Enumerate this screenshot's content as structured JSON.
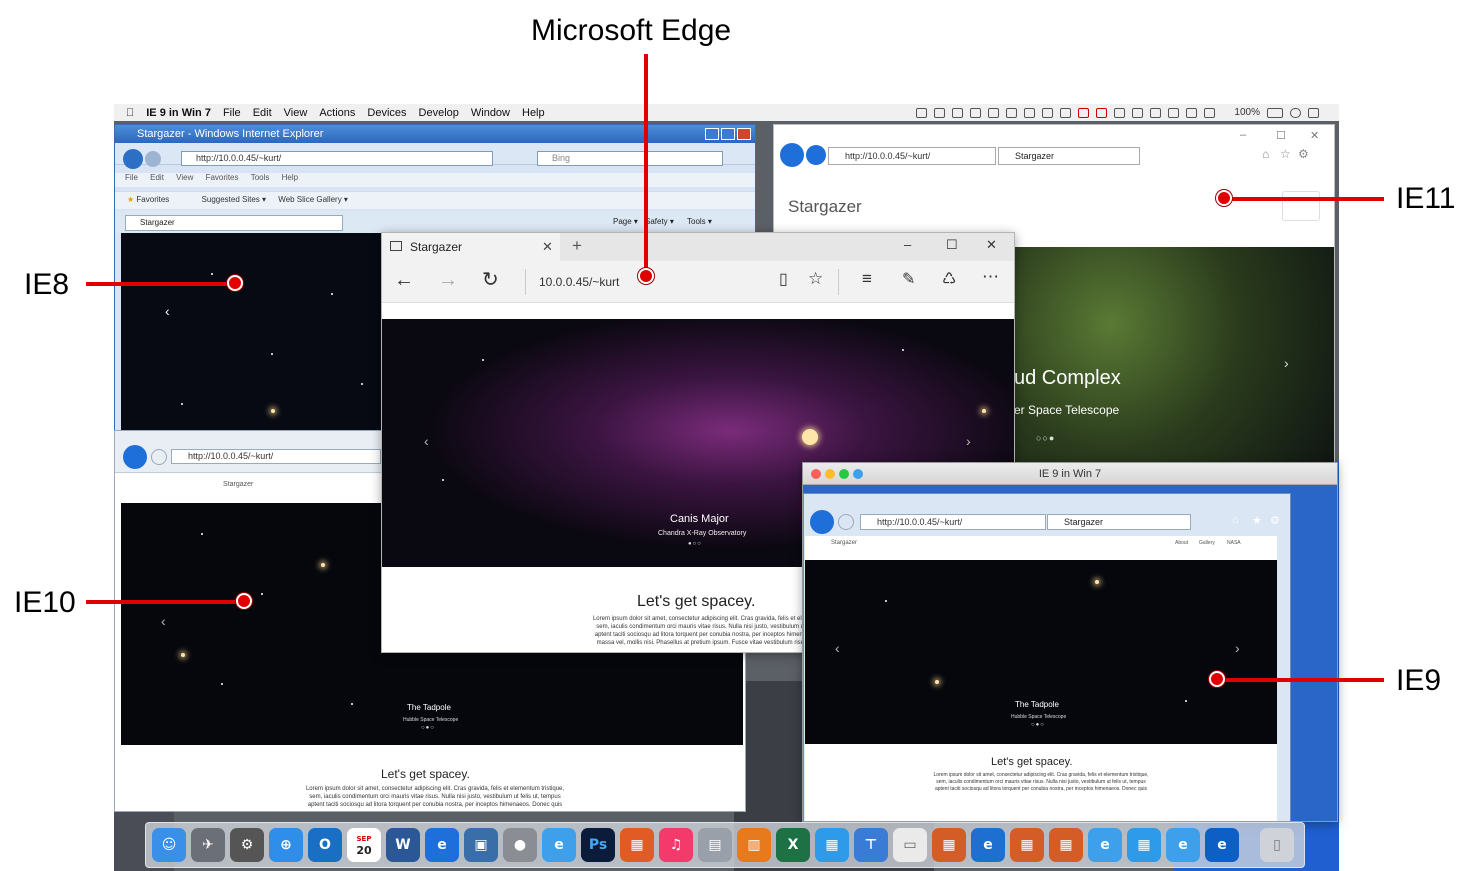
{
  "callouts": {
    "edge": "Microsoft Edge",
    "ie11": "IE11",
    "ie8": "IE8",
    "ie10": "IE10",
    "ie9": "IE9"
  },
  "menubar": {
    "app": "IE 9 in Win 7",
    "items": [
      "File",
      "Edit",
      "View",
      "Actions",
      "Devices",
      "Develop",
      "Window",
      "Help"
    ],
    "battery": "100%"
  },
  "ie8": {
    "title": "Stargazer - Windows Internet Explorer",
    "url": "http://10.0.0.45/~kurt/",
    "search_placeholder": "Bing",
    "menu": [
      "File",
      "Edit",
      "View",
      "Favorites",
      "Tools",
      "Help"
    ],
    "favorites": "Favorites",
    "suggested": "Suggested Sites ▾",
    "slice": "Web Slice Gallery ▾",
    "tab": "Stargazer",
    "commands": [
      "Page ▾",
      "Safety ▾",
      "Tools ▾"
    ]
  },
  "ie11": {
    "url": "http://10.0.0.45/~kurt/",
    "tab": "Stargazer",
    "brand": "Stargazer",
    "caption_title": "ud Complex",
    "caption_sub": "er Space Telescope"
  },
  "edge": {
    "tab": "Stargazer",
    "url": "10.0.0.45/~kurt",
    "caption_title": "Canis Major",
    "caption_sub": "Chandra X-Ray Observatory",
    "heading": "Let's get spacey.",
    "lorem1": "Lorem ipsum dolor sit amet, consectetur adipiscing elit. Cras gravida, felis et elementum tristique,",
    "lorem2": "sem, iaculis condimentum orci mauris vitae risus. Nulla nisi justo, vestibulum ut felis ut, tempus",
    "lorem3": "aptent taciti sociosqu ad litora torquent per conubia nostra, per inceptos himenaeos. Donec quis",
    "lorem4": "massa vel, mollis nisi. Phasellus at pretium ipsum. Fusce vitae vestibulum risus. Fusce fringilla"
  },
  "ie10": {
    "url": "http://10.0.0.45/~kurt/",
    "brand": "Stargazer",
    "caption_title": "The Tadpole",
    "caption_sub": "Hubble Space Telescope",
    "heading": "Let's get spacey."
  },
  "ie9": {
    "window_title": "IE 9 in Win 7",
    "url": "http://10.0.0.45/~kurt/",
    "tab": "Stargazer",
    "brand": "Stargazer",
    "nav": [
      "About",
      "Gallery",
      "NASA"
    ],
    "caption_title": "The Tadpole",
    "caption_sub": "Hubble Space Telescope",
    "heading": "Let's get spacey."
  },
  "dock": {
    "calendar_month": "SEP",
    "calendar_day": "20",
    "photoshop": "Ps"
  }
}
